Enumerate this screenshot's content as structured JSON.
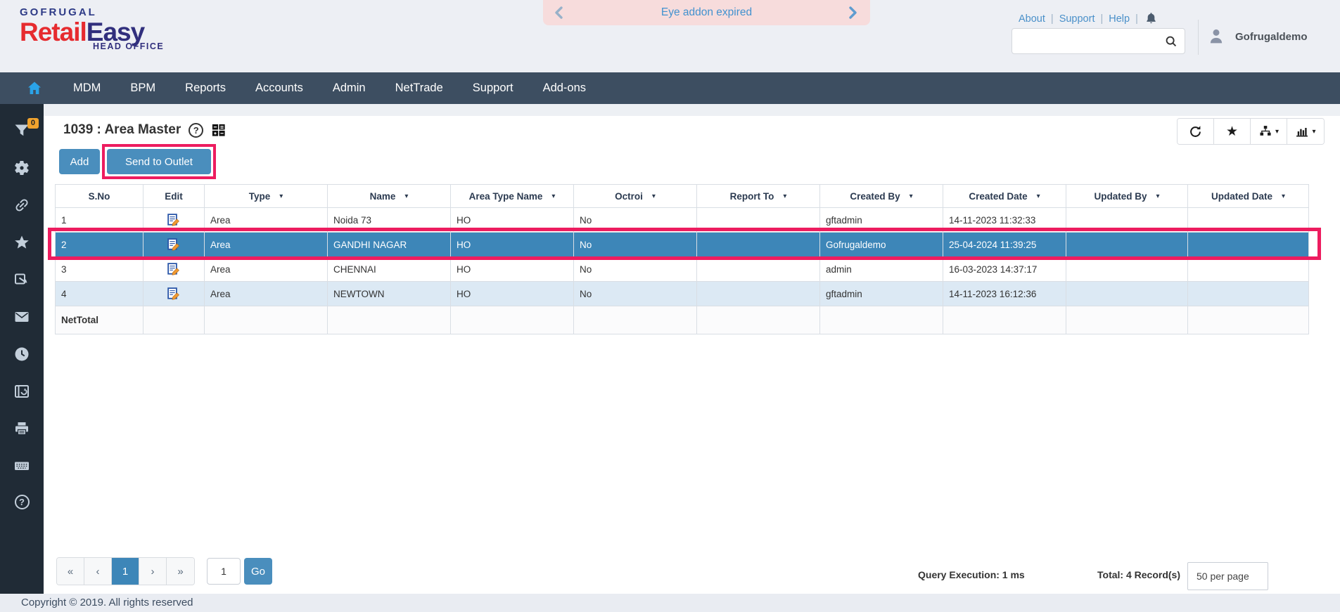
{
  "icons": {
    "question_mark": "?",
    "caret_down": "▾",
    "star": "★"
  },
  "header": {
    "brand": "GOFRUGAL",
    "product_part1": "Retail",
    "product_part2": "Easy",
    "tagline": "HEAD OFFICE",
    "banner_text": "Eye addon expired",
    "links": {
      "about": "About",
      "support": "Support",
      "help": "Help"
    },
    "link_sep": "|",
    "user_name": "Gofrugaldemo"
  },
  "nav": {
    "items": [
      "MDM",
      "BPM",
      "Reports",
      "Accounts",
      "Admin",
      "NetTrade",
      "Support",
      "Add-ons"
    ]
  },
  "sidebar": {
    "filter_badge": "0"
  },
  "main": {
    "title": "1039 : Area Master",
    "add_label": "Add",
    "send_to_outlet_label": "Send to Outlet",
    "table": {
      "headers": [
        "S.No",
        "Edit",
        "Type",
        "Name",
        "Area Type Name",
        "Octroi",
        "Report To",
        "Created By",
        "Created Date",
        "Updated By",
        "Updated Date"
      ],
      "rows": [
        {
          "sno": "1",
          "type": "Area",
          "name": "Noida 73",
          "area_type_name": "HO",
          "octroi": "No",
          "report_to": "",
          "created_by": "gftadmin",
          "created_date": "14-11-2023 11:32:33",
          "updated_by": "",
          "updated_date": ""
        },
        {
          "sno": "2",
          "type": "Area",
          "name": "GANDHI NAGAR",
          "area_type_name": "HO",
          "octroi": "No",
          "report_to": "",
          "created_by": "Gofrugaldemo",
          "created_date": "25-04-2024 11:39:25",
          "updated_by": "",
          "updated_date": ""
        },
        {
          "sno": "3",
          "type": "Area",
          "name": "CHENNAI",
          "area_type_name": "HO",
          "octroi": "No",
          "report_to": "",
          "created_by": "admin",
          "created_date": "16-03-2023 14:37:17",
          "updated_by": "",
          "updated_date": ""
        },
        {
          "sno": "4",
          "type": "Area",
          "name": "NEWTOWN",
          "area_type_name": "HO",
          "octroi": "No",
          "report_to": "",
          "created_by": "gftadmin",
          "created_date": "14-11-2023 16:12:36",
          "updated_by": "",
          "updated_date": ""
        }
      ],
      "net_total_label": "NetTotal"
    },
    "pagination": {
      "first": "«",
      "previous": "‹",
      "current_page": "1",
      "next": "›",
      "last": "»",
      "goto_value": "1",
      "go_label": "Go"
    },
    "status": {
      "query_execution": "Query Execution: 1 ms",
      "total_records": "Total: 4 Record(s)",
      "page_size": "50 per page"
    }
  },
  "footer": {
    "copyright": "Copyright © 2019. All rights reserved"
  },
  "colors": {
    "accent_blue": "#3d86b8",
    "button_blue": "#4a8ebd",
    "nav_bg": "#3d4e61",
    "sidebar_bg": "#202b36",
    "annotation_pink": "#ed1c5f",
    "banner_bg": "#f7dcdc",
    "banner_text": "#4292cf",
    "link_blue": "#4a90c9",
    "alt_row_bg": "#dce9f4",
    "badge_orange": "#f0a32e"
  }
}
